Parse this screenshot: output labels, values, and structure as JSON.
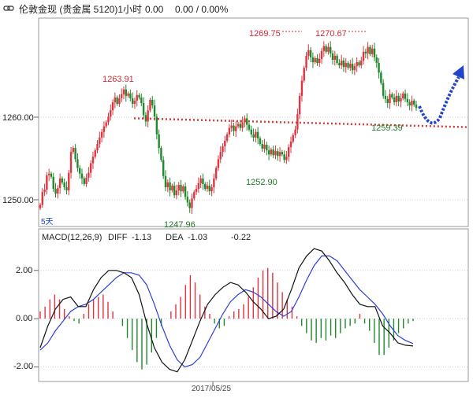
{
  "header": {
    "icon": "chart-link-icon",
    "title": "伦敦金现 (贵金属 5120)1小时",
    "last": "0.00",
    "change": "0.00 / 0.00%"
  },
  "chart_data": [
    {
      "type": "candlestick",
      "title": "",
      "ylim": [
        1246.5,
        1272.5
      ],
      "yticks": [
        1260.0,
        1250.0
      ],
      "ytick_labels": [
        "1260.00",
        "1250.00"
      ],
      "corner_label": "5天",
      "up_color": "#e0343f",
      "down_color": "#1f8a2c",
      "closes": [
        1249.2,
        1250.8,
        1251.1,
        1252.9,
        1253.1,
        1252.7,
        1251.2,
        1250.6,
        1251.3,
        1252.5,
        1252.0,
        1251.4,
        1251.0,
        1253.2,
        1255.8,
        1256.3,
        1254.9,
        1253.8,
        1253.1,
        1252.5,
        1251.8,
        1252.6,
        1253.2,
        1254.4,
        1255.2,
        1256.0,
        1256.8,
        1257.6,
        1258.3,
        1259.0,
        1259.5,
        1260.2,
        1261.0,
        1262.0,
        1262.6,
        1261.8,
        1262.5,
        1263.0,
        1263.6,
        1262.8,
        1263.1,
        1262.5,
        1261.8,
        1262.2,
        1262.9,
        1262.6,
        1261.9,
        1260.4,
        1259.6,
        1261.0,
        1262.3,
        1261.6,
        1260.2,
        1258.0,
        1256.3,
        1254.8,
        1252.8,
        1251.4,
        1252.0,
        1251.0,
        1251.6,
        1250.4,
        1251.0,
        1251.7,
        1250.9,
        1251.5,
        1250.2,
        1249.5,
        1248.8,
        1250.0,
        1250.8,
        1251.2,
        1251.9,
        1252.5,
        1251.8,
        1251.2,
        1251.6,
        1250.9,
        1251.4,
        1252.5,
        1253.8,
        1254.9,
        1255.8,
        1256.5,
        1257.2,
        1258.0,
        1258.8,
        1259.1,
        1258.4,
        1259.0,
        1259.3,
        1258.8,
        1259.5,
        1260.0,
        1259.2,
        1258.6,
        1258.0,
        1257.6,
        1258.3,
        1257.5,
        1256.8,
        1256.2,
        1256.7,
        1256.0,
        1255.5,
        1256.1,
        1255.4,
        1255.9,
        1255.3,
        1255.8,
        1255.5,
        1254.8,
        1255.2,
        1256.4,
        1257.1,
        1257.9,
        1258.6,
        1260.5,
        1262.8,
        1264.7,
        1266.3,
        1267.8,
        1268.5,
        1267.6,
        1267.0,
        1267.5,
        1266.9,
        1267.4,
        1268.4,
        1269.0,
        1268.3,
        1268.9,
        1268.1,
        1267.3,
        1267.8,
        1266.9,
        1266.6,
        1267.2,
        1266.4,
        1266.9,
        1266.3,
        1266.8,
        1266.0,
        1266.5,
        1267.0,
        1266.6,
        1267.2,
        1268.3,
        1268.1,
        1268.9,
        1268.0,
        1268.7,
        1267.6,
        1266.9,
        1265.7,
        1264.4,
        1262.8,
        1262.4,
        1261.9,
        1263.0,
        1262.6,
        1262.0,
        1262.8,
        1262.1,
        1262.5,
        1263.1,
        1262.4,
        1262.0,
        1261.6,
        1262.2,
        1261.7,
        1261.3
      ]
    },
    {
      "type": "macd",
      "legend": {
        "name": "MACD(12,26,9)",
        "diff_label": "DIFF",
        "diff_value": "-1.13",
        "dea_label": "DEA",
        "dea_value": "-1.03",
        "macd_value": "-0.22"
      },
      "ylim": [
        -2.6,
        3.1
      ],
      "yticks": [
        2.0,
        0.0,
        -2.0
      ],
      "ytick_labels": [
        "2.00",
        "0.00",
        "-2.00"
      ],
      "xtick_label": "2017/05/25",
      "diff_color": "#111111",
      "dea_color": "#2b3fd6",
      "hist_pos_color": "#e0343f",
      "hist_neg_color": "#1f8a2c",
      "diff": [
        -1.2,
        -0.3,
        0.4,
        0.8,
        0.9,
        0.5,
        0.5,
        1.2,
        1.7,
        2.0,
        2.0,
        1.9,
        1.7,
        1.0,
        -0.2,
        -1.2,
        -1.8,
        -2.1,
        -2.2,
        -1.7,
        -0.9,
        -0.1,
        0.6,
        1.0,
        1.3,
        1.5,
        1.4,
        1.1,
        0.7,
        0.4,
        0.0,
        0.1,
        0.4,
        1.2,
        2.1,
        2.6,
        2.9,
        2.8,
        2.4,
        1.9,
        1.5,
        1.0,
        0.6,
        0.5,
        0.5,
        -0.3,
        -0.6,
        -1.0,
        -1.1,
        -1.13
      ],
      "dea": [
        -1.3,
        -1.0,
        -0.5,
        -0.1,
        0.3,
        0.5,
        0.6,
        0.8,
        1.1,
        1.4,
        1.7,
        1.9,
        1.9,
        1.8,
        1.4,
        0.6,
        -0.3,
        -1.1,
        -1.7,
        -2.0,
        -1.9,
        -1.6,
        -1.0,
        -0.4,
        0.2,
        0.7,
        1.0,
        1.2,
        1.1,
        0.9,
        0.6,
        0.3,
        0.1,
        0.3,
        0.9,
        1.6,
        2.2,
        2.6,
        2.6,
        2.4,
        2.0,
        1.6,
        1.2,
        0.9,
        0.6,
        0.2,
        -0.3,
        -0.7,
        -0.9,
        -1.03
      ],
      "histogram": [
        0.3,
        0.5,
        0.8,
        1.0,
        0.8,
        0.4,
        0.1,
        -0.1,
        -0.2,
        0.2,
        0.6,
        0.8,
        0.9,
        1.0,
        0.7,
        0.3,
        0.0,
        -0.3,
        -0.8,
        -1.3,
        -1.8,
        -2.1,
        -1.9,
        -1.4,
        -0.8,
        -0.3,
        0.0,
        0.3,
        0.6,
        0.9,
        1.4,
        1.8,
        1.5,
        1.0,
        0.5,
        0.2,
        -0.2,
        -0.4,
        -0.3,
        0.1,
        0.3,
        0.4,
        0.6,
        0.9,
        1.3,
        1.7,
        2.0,
        2.1,
        1.9,
        1.5,
        1.1,
        0.8,
        0.5,
        0.1,
        -0.3,
        -0.6,
        -0.9,
        -1.0,
        -0.8,
        -0.9,
        -0.7,
        -0.8,
        -0.6,
        -0.4,
        -0.3,
        -0.2,
        0.2,
        -0.2,
        -0.5,
        -1.0,
        -1.5,
        -1.5,
        -1.2,
        -0.9,
        -0.6,
        -0.4,
        -0.2,
        -0.1
      ]
    }
  ],
  "annotations": [
    {
      "text": "1263.91",
      "color": "#d02a35"
    },
    {
      "text": "1269.75",
      "color": "#d02a35"
    },
    {
      "text": "1270.67",
      "color": "#d02a35"
    },
    {
      "text": "1247.96",
      "color": "#1f7a28"
    },
    {
      "text": "1252.90",
      "color": "#1f7a28"
    },
    {
      "text": "1259.39",
      "color": "#1f7a28"
    }
  ],
  "trend_line": {
    "color": "#d43a3a",
    "from_price": 1260.0,
    "to_price": 1258.9
  },
  "forecast_arrow": {
    "color": "#2244cc"
  }
}
